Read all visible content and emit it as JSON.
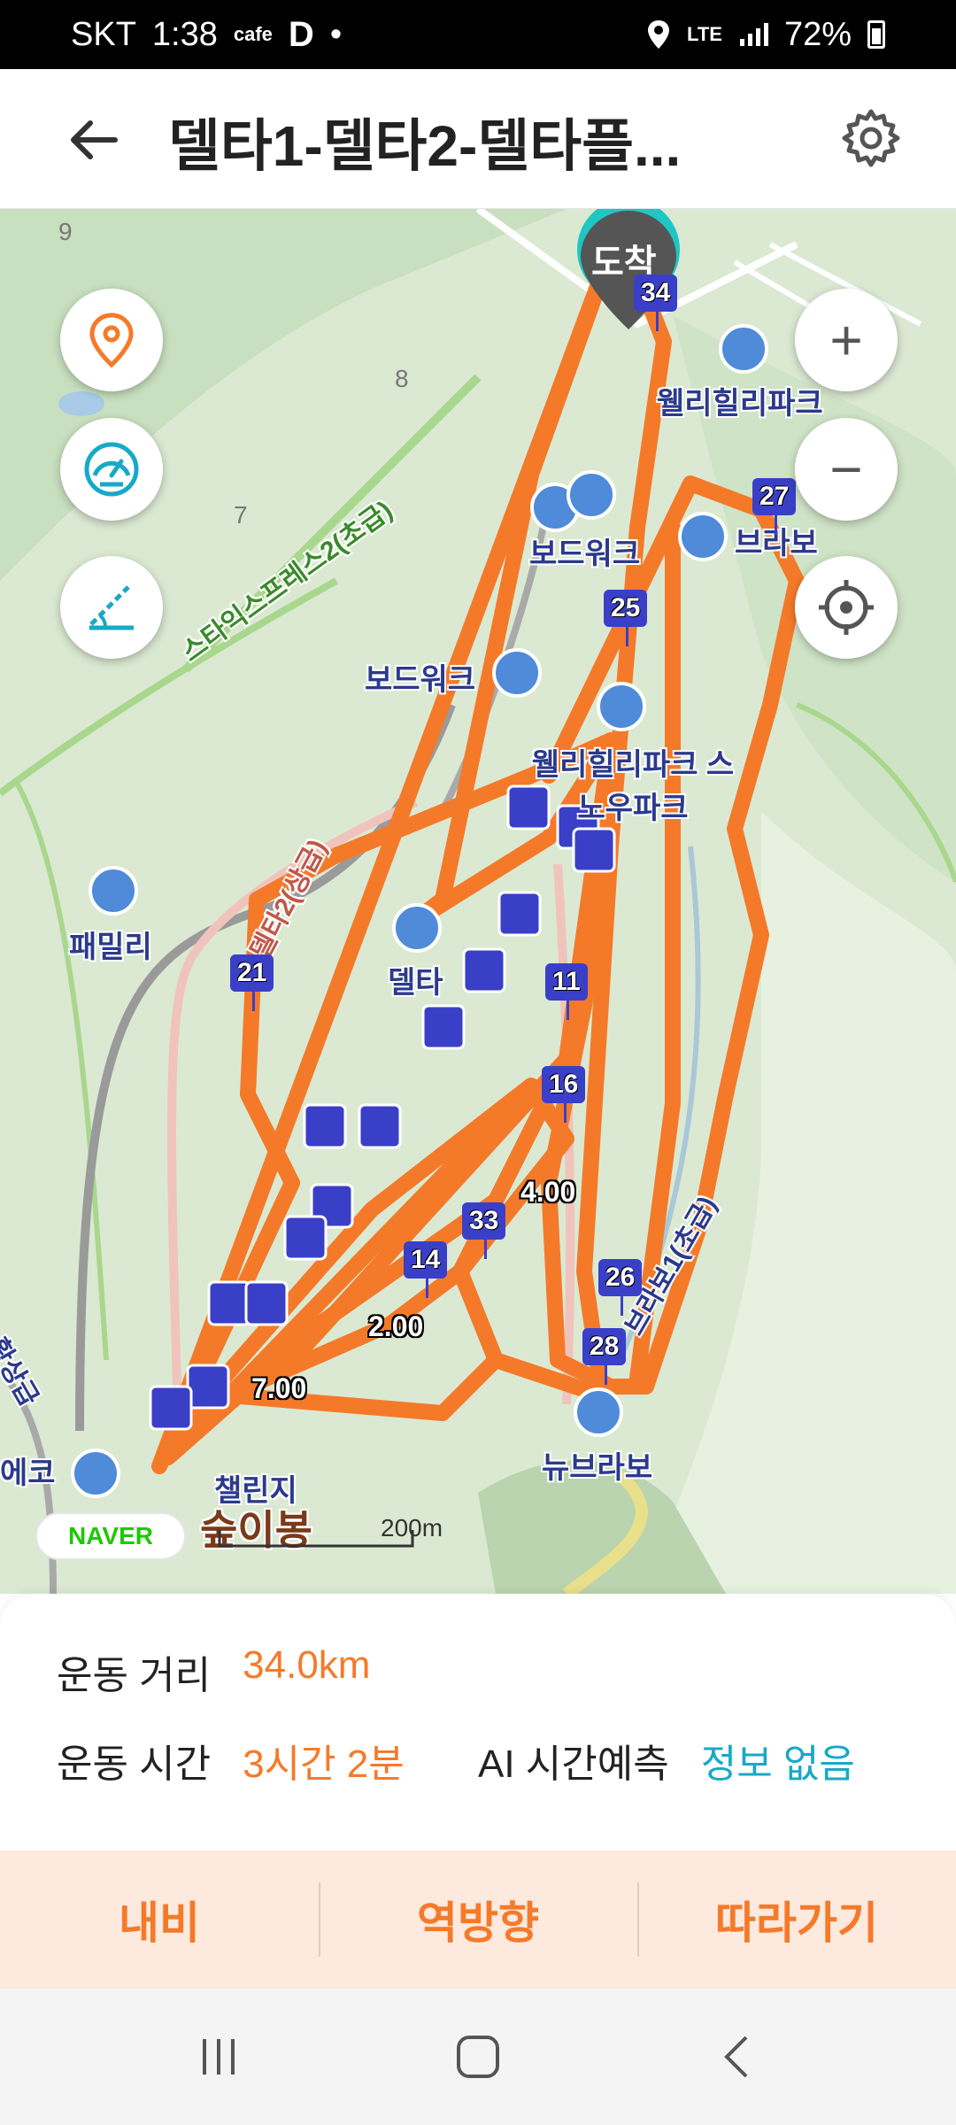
{
  "status_bar": {
    "carrier": "SKT",
    "time": "1:38",
    "cafe_label": "cafe",
    "app_letter": "D",
    "dot": "•",
    "network": "LTE",
    "battery": "72%"
  },
  "header": {
    "title": "델타1-델타2-델타플...",
    "back_icon": "back-arrow-icon",
    "settings_icon": "gear-icon"
  },
  "map": {
    "labels": {
      "wellihilli_park": "웰리힐리파크",
      "bravo": "브라보",
      "boardwalk_top": "보드워크",
      "boardwalk": "보드워크",
      "snowpark": "웰리힐리파크 스노우파크",
      "family": "패밀리",
      "delta": "델타",
      "new_bravo": "뉴브라보",
      "challenge": "챌린지",
      "eco": "에코",
      "star_express": "스타익스프레스2(초급)",
      "red_slope": "델타2(상급)",
      "bravo_slope": "브라보1(초급)",
      "hwang": "황상급",
      "num_9": "9",
      "num_8": "8",
      "num_7": "7"
    },
    "arrival_label": "도착",
    "markers": {
      "m34": "34",
      "m27": "27",
      "m25": "25",
      "m21": "21",
      "m11": "11",
      "m16": "16",
      "m33": "33",
      "m14": "14",
      "m26": "26",
      "m28": "28",
      "d4": "4.00",
      "d2": "2.00",
      "d7": "7.00"
    },
    "naver_logo": "NAVER",
    "scale_label": "200m",
    "watermark": "숲이봉",
    "route_color": "#f47a2a",
    "marker_color": "#3a3fc8",
    "controls": {
      "location_icon": "location-pin-icon",
      "speed_icon": "speedometer-icon",
      "slope_icon": "slope-icon",
      "zoom_in": "+",
      "zoom_out": "−",
      "target_icon": "crosshair-icon"
    }
  },
  "summary": {
    "distance_label": "운동 거리",
    "distance_value": "34.0km",
    "time_label": "운동 시간",
    "time_value": "3시간 2분",
    "ai_label": "AI 시간예측",
    "ai_value": "정보 없음"
  },
  "actions": {
    "navi": "내비",
    "reverse": "역방향",
    "follow": "따라가기"
  },
  "nav_bar": {
    "recents_icon": "recents-icon",
    "home_icon": "home-icon",
    "back_icon": "nav-back-icon"
  }
}
